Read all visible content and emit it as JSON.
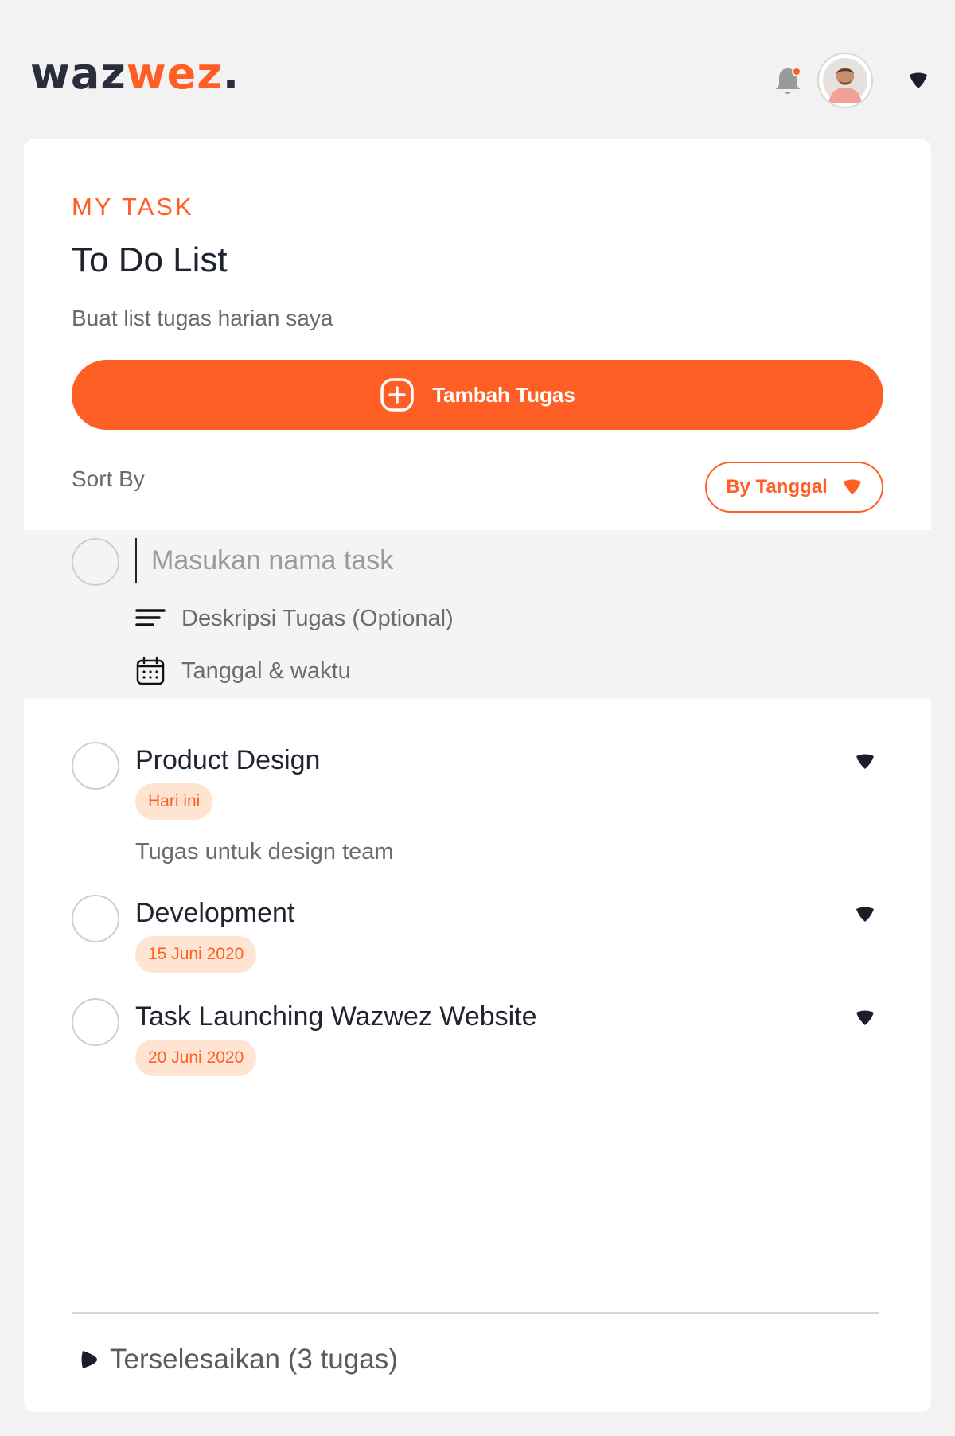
{
  "header": {
    "logo_part1": "waz",
    "logo_part2": "wez",
    "logo_dot": ".",
    "bell_icon": "bell-icon",
    "avatar_icon": "user-avatar",
    "menu_icon": "chevron-down-icon"
  },
  "colors": {
    "accent": "#ff5f24",
    "badge_bg": "#ffe4d2",
    "text_dark": "#1f2430",
    "text_muted": "#6b6b6b",
    "form_bg": "#f4f4f4"
  },
  "card": {
    "eyebrow": "MY TASK",
    "title": "To Do List",
    "subtitle": "Buat list tugas harian saya",
    "add_button": "Tambah Tugas",
    "sort_label": "Sort By",
    "sort_value": "By Tanggal"
  },
  "new_task": {
    "name_placeholder": "Masukan nama task",
    "description_placeholder": "Deskripsi Tugas (Optional)",
    "date_placeholder": "Tanggal & waktu"
  },
  "tasks": [
    {
      "title": "Product Design",
      "badge": "Hari ini",
      "description": "Tugas untuk design team"
    },
    {
      "title": "Development",
      "badge": "15 Juni 2020",
      "description": ""
    },
    {
      "title": "Task Launching Wazwez Website",
      "badge": "20 Juni 2020",
      "description": ""
    }
  ],
  "footer": {
    "completed_label": "Terselesaikan (3 tugas)"
  }
}
